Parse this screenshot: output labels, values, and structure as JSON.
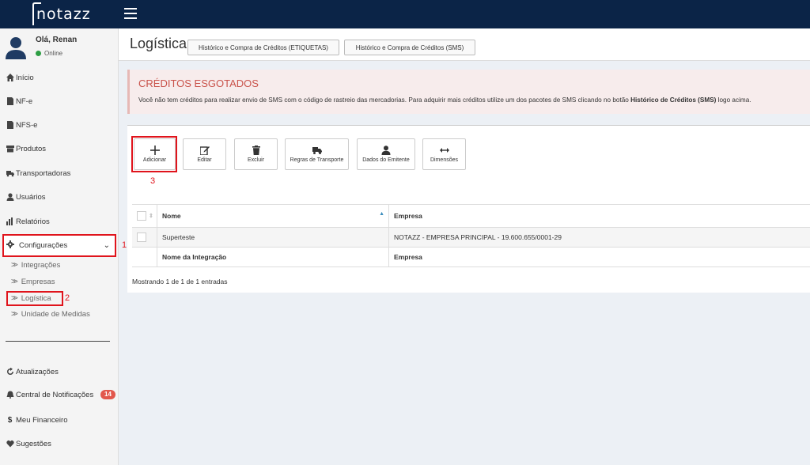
{
  "brand": {
    "logo_text": "notazz"
  },
  "user": {
    "greeting": "Olá, Renan",
    "status": "Online"
  },
  "sidebar": {
    "items": [
      {
        "label": "Início",
        "icon": "home-icon"
      },
      {
        "label": "NF-e",
        "icon": "document-icon"
      },
      {
        "label": "NFS-e",
        "icon": "document-icon"
      },
      {
        "label": "Produtos",
        "icon": "archive-icon"
      },
      {
        "label": "Transportadoras",
        "icon": "truck-icon"
      },
      {
        "label": "Usuários",
        "icon": "user-icon"
      },
      {
        "label": "Relatórios",
        "icon": "bar-chart-icon"
      }
    ],
    "config": {
      "label": "Configurações",
      "icon": "gear-icon"
    },
    "subitems": [
      "Integrações",
      "Empresas",
      "Logística",
      "Unidade de Medidas"
    ],
    "bottom_items": [
      {
        "label": "Atualizações",
        "icon": "refresh-icon"
      },
      {
        "label": "Central de Notificações",
        "icon": "bell-icon"
      },
      {
        "label": "Meu Financeiro",
        "icon": "dollar-icon"
      },
      {
        "label": "Sugestões",
        "icon": "heart-icon"
      }
    ],
    "notifications_count": "14"
  },
  "annotations": {
    "step1": "1",
    "step2": "2",
    "step3": "3"
  },
  "header": {
    "title": "Logística",
    "btn_etiquetas": "Histórico e Compra de Créditos (ETIQUETAS)",
    "btn_sms": "Histórico e Compra de Créditos (SMS)"
  },
  "alert": {
    "title": "CRÉDITOS ESGOTADOS",
    "text_before": "Você não tem créditos para realizar envio de SMS com o código de rastreio das mercadorias. Para adquirir mais créditos utilize um dos pacotes de SMS clicando no botão ",
    "text_bold": "Histórico de Créditos (SMS)",
    "text_after": " logo acima."
  },
  "toolbar": {
    "add": "Adicionar",
    "edit": "Editar",
    "delete": "Excluir",
    "transport_rules": "Regras de Transporte",
    "issuer_data": "Dados do Emitente",
    "dimensions": "Dimensões"
  },
  "table": {
    "columns": [
      "Nome",
      "Empresa"
    ],
    "rows": [
      {
        "nome": "Superteste",
        "empresa": "NOTAZZ - EMPRESA PRINCIPAL - 19.600.655/0001-29"
      }
    ],
    "footer_columns": [
      "Nome da Integração",
      "Empresa"
    ],
    "info": "Mostrando 1 de 1 de 1 entradas"
  },
  "colors": {
    "topbar": "#0b2447",
    "highlight": "#e0141c",
    "alert_title": "#c9524a",
    "badge": "#e2574c",
    "online": "#2e9e44"
  }
}
